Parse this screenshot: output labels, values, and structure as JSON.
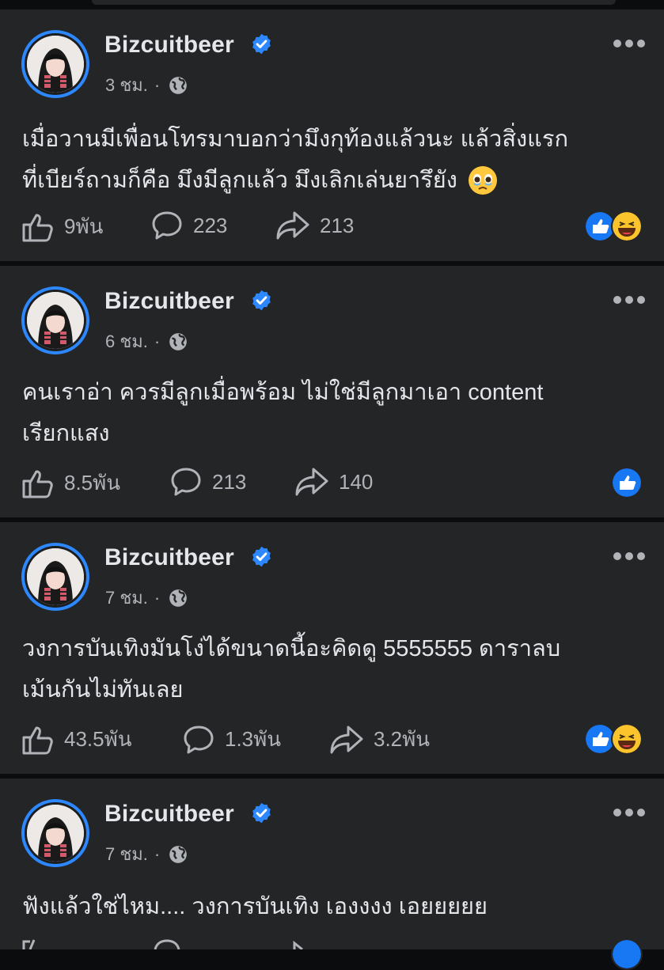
{
  "posts": [
    {
      "author": "Bizcuitbeer",
      "time": "3 ชม.",
      "text_lines": [
        "เมื่อวานมีเพื่อนโทรมาบอกว่ามึงกุท้องแล้วนะ แล้วสิ่งแรก",
        "ที่เบียร์ถามก็คือ มึงมีลูกแล้ว มึงเลิกเล่นยารึยัง"
      ],
      "likes": "9พัน",
      "comments": "223",
      "shares": "213",
      "reactions": [
        "like",
        "haha"
      ]
    },
    {
      "author": "Bizcuitbeer",
      "time": "6 ชม.",
      "text_lines": [
        "คนเราอ่า ควรมีลูกเมื่อพร้อม ไม่ใช่มีลูกมาเอา content",
        "เรียกแสง"
      ],
      "likes": "8.5พัน",
      "comments": "213",
      "shares": "140",
      "reactions": [
        "like"
      ]
    },
    {
      "author": "Bizcuitbeer",
      "time": "7 ชม.",
      "text_lines": [
        "วงการบันเทิงมันโง่ได้ขนาดนี้อะคิดดู 5555555 ดาราลบ",
        "เม้นกันไม่ทันเลย"
      ],
      "likes": "43.5พัน",
      "comments": "1.3พัน",
      "shares": "3.2พัน",
      "reactions": [
        "like",
        "haha"
      ]
    },
    {
      "author": "Bizcuitbeer",
      "time": "7 ชม.",
      "text_lines": [
        "ฟังแล้วใช่ไหม.... วงการบันเทิง เองงงง เอยยยยย"
      ],
      "likes": "",
      "comments": "",
      "shares": "",
      "reactions": []
    }
  ],
  "colors": {
    "accent": "#2d88ff",
    "card": "#242526",
    "background": "#0b0c0e",
    "muted": "#b0b3b8",
    "text": "#e4e6eb"
  },
  "icons": [
    "globe-icon",
    "verified-badge-icon",
    "more-options-icon",
    "like-thumb-icon",
    "comment-bubble-icon",
    "share-arrow-icon",
    "like-reaction-icon",
    "haha-reaction-icon",
    "crying-face-emoji"
  ]
}
